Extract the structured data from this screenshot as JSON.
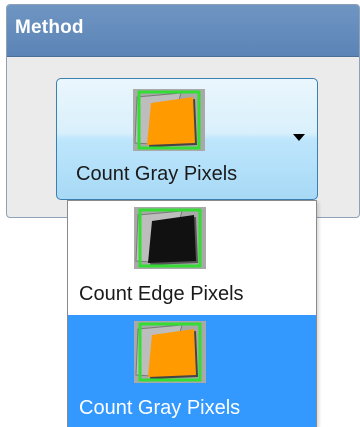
{
  "group": {
    "title": "Method"
  },
  "combo": {
    "selected_label": "Count Gray Pixels",
    "selected_icon": "gray-pixels-icon"
  },
  "dropdown": {
    "items": [
      {
        "label": "Count Edge Pixels",
        "icon": "edge-pixels-icon",
        "selected": false
      },
      {
        "label": "Count Gray Pixels",
        "icon": "gray-pixels-icon",
        "selected": true
      }
    ]
  },
  "colors": {
    "header_blue": "#5b84b6",
    "selection_blue": "#3399ff",
    "thumb_frame_green": "#33dd33",
    "gray_fill": "#ff9a00",
    "edge_fill": "#111111"
  }
}
